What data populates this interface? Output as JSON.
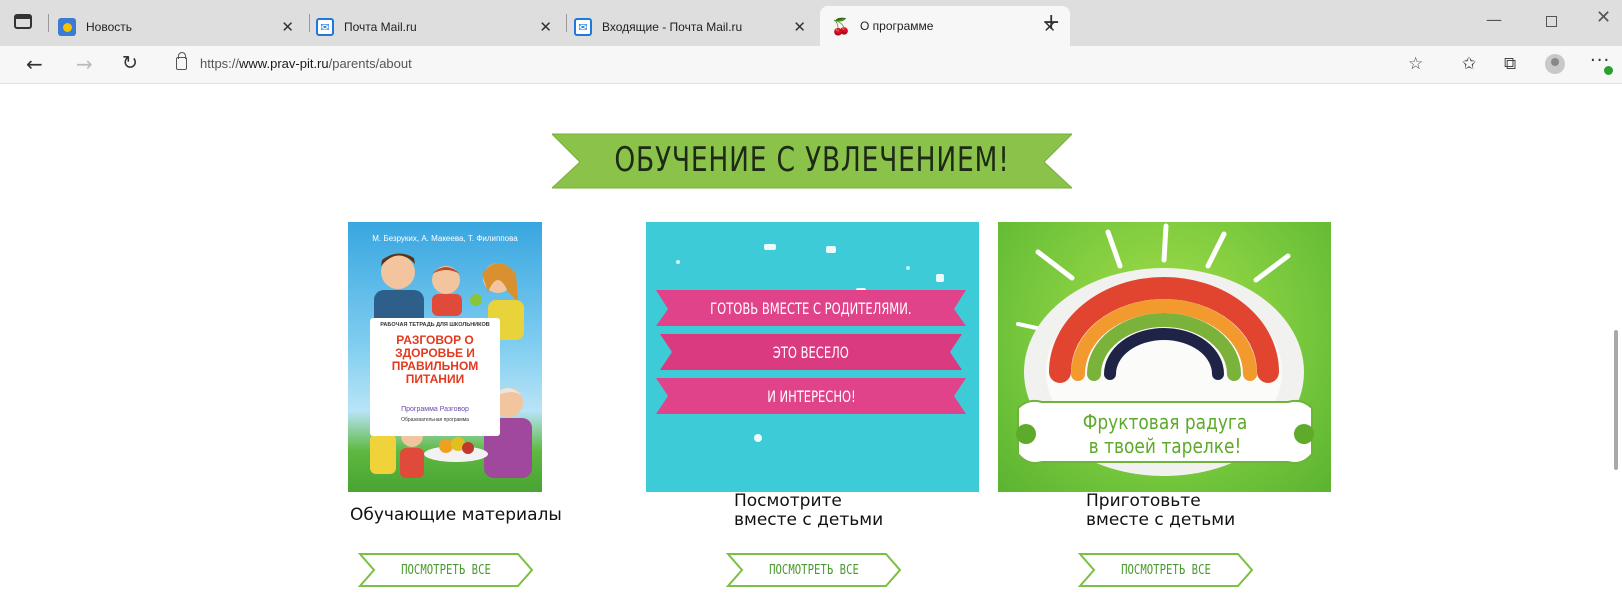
{
  "browser": {
    "tabs": [
      {
        "title": "Новость",
        "icon": "news-favicon-icon",
        "active": false
      },
      {
        "title": "Почта Mail.ru",
        "icon": "mail-favicon-icon",
        "active": false
      },
      {
        "title": "Входящие - Почта Mail.ru",
        "icon": "mail-favicon-icon",
        "active": false
      },
      {
        "title": "О программе",
        "icon": "cherry-favicon-icon",
        "active": true
      }
    ],
    "url_prefix": "https://",
    "url_domain": "www.prav-pit.ru",
    "url_path": "/parents/about"
  },
  "page": {
    "banner": "ОБУЧЕНИЕ С УВЛЕЧЕНИЕМ!",
    "cards": [
      {
        "caption": "Обучающие материалы",
        "button": "ПОСМОТРЕТЬ ВСЕ",
        "image": {
          "authors": "М. Безруких, А. Макеева, Т. Филиппова",
          "subtitle": "РАБОЧАЯ ТЕТРАДЬ ДЛЯ ШКОЛЬНИКОВ",
          "title": "РАЗГОВОР О ЗДОРОВЬЕ И ПРАВИЛЬНОМ ПИТАНИИ",
          "foot1": "Программа Разговор",
          "foot2": "Образовательная программа"
        }
      },
      {
        "caption_line1": "Посмотрите",
        "caption_line2": "вместе с детьми",
        "button": "ПОСМОТРЕТЬ ВСЕ",
        "image": {
          "ribbons": [
            "ГОТОВЬ ВМЕСТЕ С РОДИТЕЛЯМИ.",
            "ЭТО ВЕСЕЛО",
            "И ИНТЕРЕСНО!"
          ]
        }
      },
      {
        "caption_line1": "Приготовьте",
        "caption_line2": "вместе с детьми",
        "button": "ПОСМОТРЕТЬ ВСЕ",
        "image": {
          "line1": "Фруктовая радуга",
          "line2": "в твоей тарелке!"
        }
      }
    ]
  },
  "colors": {
    "banner_green": "#8bc34a",
    "button_green": "#7cbf45",
    "ribbon_pink": "#e0438a",
    "cyan": "#3ecbd8"
  }
}
